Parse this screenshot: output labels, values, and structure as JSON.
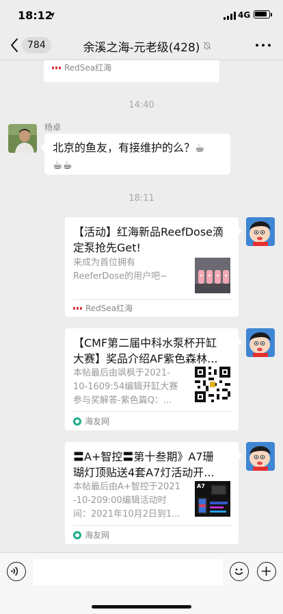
{
  "status_bar": {
    "time": "18:12",
    "network": "4G"
  },
  "nav": {
    "back_count": "784",
    "title": "余溪之海-元老级(428)"
  },
  "messages": {
    "prev_card": {
      "source": "RedSea红海"
    },
    "time_1": "14:40",
    "msg_yangzhuo": {
      "sender": "杨卓",
      "text_line1": "北京的鱼友，有接维护的么？☕",
      "text_line2": "☕☕"
    },
    "time_2": "18:11",
    "link_1": {
      "title_line1": "【活动】红海新品ReefDose滴",
      "title_line2": "定泵抢先Get!",
      "desc_line1": "来成为首位拥有",
      "desc_line2": "ReeferDose的用户吧~",
      "source": "RedSea红海"
    },
    "link_2": {
      "title_line1": "【CMF第二届中科水泵杯开缸",
      "title_line2": "大赛】奖品介绍AF紫色森林...",
      "desc_line1": "本帖最后由飒枫于2021-",
      "desc_line2": "10-1609:54编辑开缸大赛",
      "desc_line3": "参与奖解答-紫色篇Q：...",
      "source": "海友网"
    },
    "link_3": {
      "title_line1": "〓A+智控〓第十叁期》A7珊",
      "title_line2": "瑚灯顶贴送4套A7灯活动开...",
      "desc_line1": "本帖最后由A+智控于2021",
      "desc_line2": "-10-209:00编辑活动时",
      "desc_line3": "间：2021年10月2日到1...",
      "thumb_label": "A7",
      "source": "海友网"
    }
  },
  "input": {
    "value": ""
  },
  "colors": {
    "background": "#ededed",
    "bubble": "#ffffff",
    "timestamp": "#a8a8a8",
    "source_red": "#d8303a",
    "source_green": "#1aad8a"
  }
}
